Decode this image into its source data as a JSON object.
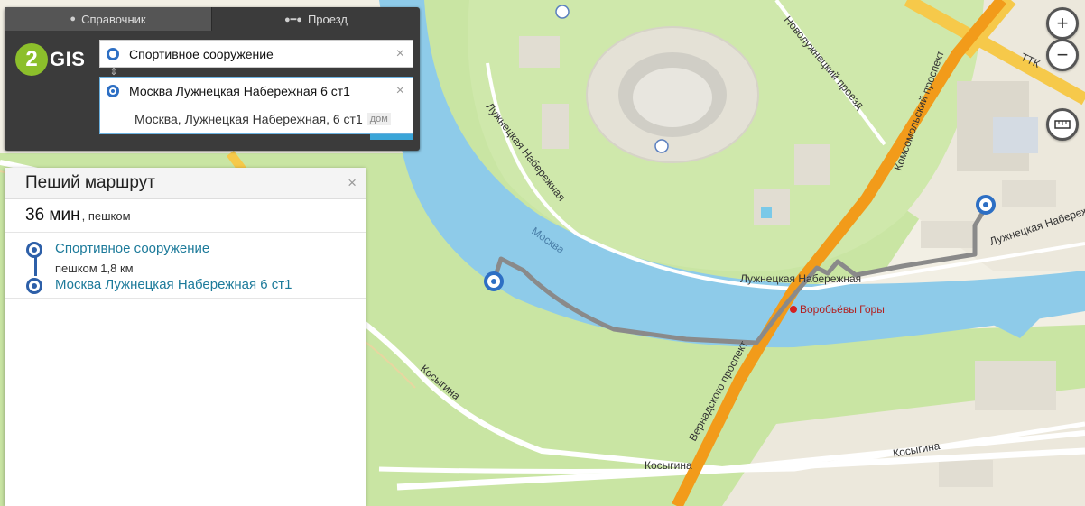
{
  "tabs": [
    {
      "label": "Справочник",
      "icon": "pin-icon"
    },
    {
      "label": "Проезд",
      "icon": "route-icon"
    }
  ],
  "logo": {
    "text": "GIS",
    "mark": "2"
  },
  "route_form": {
    "from_value": "Спортивное сооружение",
    "to_value": "Москва Лужнецкая Набережная 6 ст1",
    "clear_symbol": "×",
    "suggestion": {
      "text": "Москва, Лужнецкая Набережная, 6 ст1",
      "tag": "дом"
    }
  },
  "route_panel": {
    "title": "Пеший маршрут",
    "close": "×",
    "duration": "36 мин",
    "mode": ", пешком",
    "start": "Спортивное сооружение",
    "distance": "пешком 1,8 км",
    "end": "Москва Лужнецкая Набережная 6 ст1"
  },
  "map_labels": {
    "luzh_nab_1": "Лужнецкая Набережная",
    "luzh_nab_2": "Лужнецкая Набережная",
    "luzh_nab_3": "Лужнецкая Набережная",
    "novoluzh": "Новолужнецкий проезд",
    "komsomolsky": "Комсомольский проспект",
    "ttk": "ТТК",
    "river": "Москва",
    "vernadskogo": "Вернадского проспект",
    "kosygina_1": "Косыгина",
    "kosygina_2": "Косыгина",
    "kosygina_3": "Косыгина",
    "vorobyovy": "Воробьёвы Горы"
  },
  "zoom": {
    "in": "+",
    "out": "−"
  },
  "colors": {
    "accent": "#2d6fc4",
    "route": "#8a8a8a",
    "river": "#8ecbe9",
    "park": "#c6e39d"
  }
}
